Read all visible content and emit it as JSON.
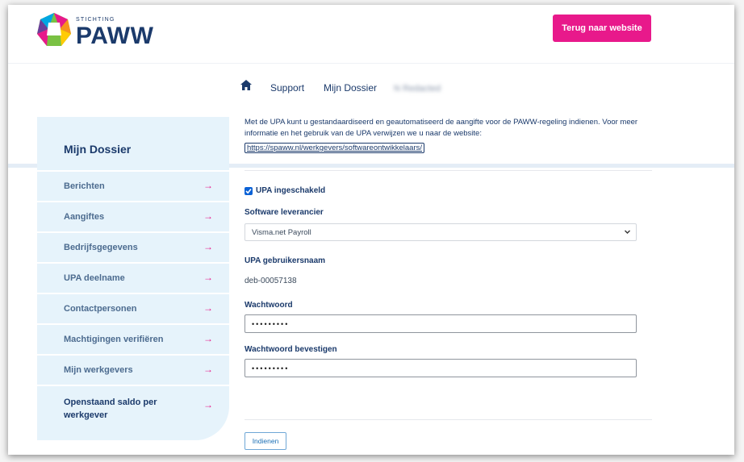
{
  "header": {
    "logo_sub": "STICHTING",
    "logo_main": "PAWW",
    "back_button": "Terug naar website"
  },
  "nav": {
    "home_icon": "home-icon",
    "items": [
      "Support",
      "Mijn Dossier"
    ],
    "blurred_user": "N Redacted"
  },
  "sidebar": {
    "title": "Mijn Dossier",
    "arrow_icon": "arrow-right-icon",
    "items": [
      {
        "label": "Berichten"
      },
      {
        "label": "Aangiftes"
      },
      {
        "label": "Bedrijfsgegevens"
      },
      {
        "label": "UPA deelname"
      },
      {
        "label": "Contactpersonen"
      },
      {
        "label": "Machtigingen verifiëren"
      },
      {
        "label": "Mijn werkgevers"
      },
      {
        "label": "Openstaand saldo per werkgever"
      }
    ]
  },
  "main": {
    "intro_text": "Met de UPA kunt u gestandaardiseerd en geautomatiseerd de aangifte voor de PAWW-regeling indienen. Voor meer informatie en het gebruik van de UPA verwijzen we u naar de website:",
    "intro_link": "https://spaww.nl/werkgevers/softwareontwikkelaars/",
    "upa_checkbox": {
      "label": "UPA ingeschakeld",
      "checked": true
    },
    "software_label": "Software leverancier",
    "software_value": "Visma.net Payroll",
    "username_label": "UPA gebruikersnaam",
    "username_value": "deb-00057138",
    "password_label": "Wachtwoord",
    "password_value": "•••••••••",
    "password_confirm_label": "Wachtwoord bevestigen",
    "password_confirm_value": "•••••••••",
    "submit_label": "Indienen"
  },
  "colors": {
    "brand_navy": "#1b3a6b",
    "accent_pink": "#e8198b",
    "sidebar_bg": "#e6f3fb"
  }
}
